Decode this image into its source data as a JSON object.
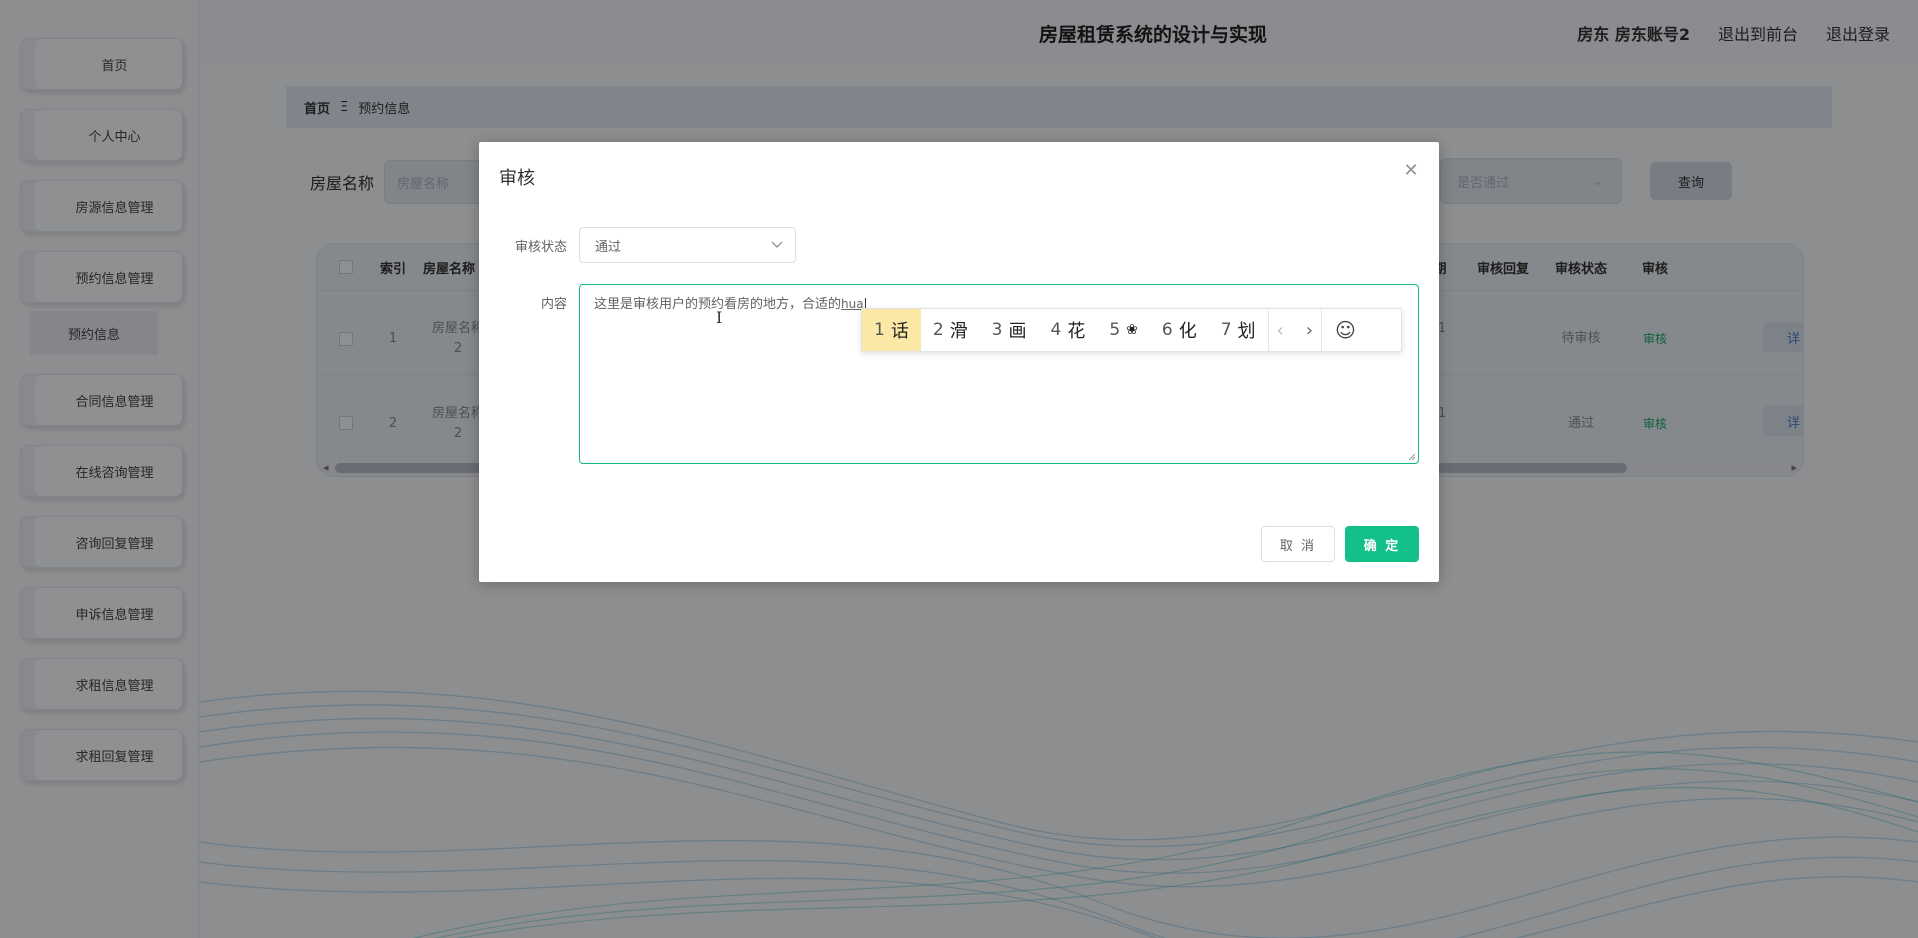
{
  "app": {
    "title": "房屋租赁系统的设计与实现",
    "user_label": "房东 房东账号2",
    "to_front": "退出到前台",
    "logout": "退出登录"
  },
  "sidebar": {
    "items": [
      {
        "label": "首页"
      },
      {
        "label": "个人中心"
      },
      {
        "label": "房源信息管理"
      },
      {
        "label": "预约信息管理"
      },
      {
        "label": "合同信息管理"
      },
      {
        "label": "在线咨询管理"
      },
      {
        "label": "咨询回复管理"
      },
      {
        "label": "申诉信息管理"
      },
      {
        "label": "求租信息管理"
      },
      {
        "label": "求租回复管理"
      }
    ],
    "sub_item": "预约信息"
  },
  "breadcrumb": {
    "home": "首页",
    "separator": "Ξ",
    "current": "预约信息"
  },
  "search": {
    "house_name_label": "房屋名称",
    "house_name_placeholder": "房屋名称",
    "passed_placeholder": "是否通过",
    "query_button": "查询"
  },
  "table": {
    "headers": {
      "index": "索引",
      "house_name": "房屋名称",
      "date_fragment": "期",
      "review_reply": "审核回复",
      "review_status": "审核状态",
      "review": "审核"
    },
    "rows": [
      {
        "index": "1",
        "house_name_line1": "房屋名称",
        "house_name_line2": "2",
        "date_fragment": "1",
        "status": "待审核",
        "review": "审核",
        "detail": "详"
      },
      {
        "index": "2",
        "house_name_line1": "房屋名称",
        "house_name_line2": "2",
        "date_fragment": "1",
        "status": "通过",
        "review": "审核",
        "detail": "详"
      }
    ]
  },
  "dialog": {
    "title": "审核",
    "status_label": "审核状态",
    "status_value": "通过",
    "content_label": "内容",
    "content_text": "这里是审核用户的预约看房的地方，合适的",
    "content_pinyin": "hua",
    "cancel": "取 消",
    "confirm": "确 定"
  },
  "ime": {
    "candidates": [
      {
        "num": "1",
        "text": "话"
      },
      {
        "num": "2",
        "text": "滑"
      },
      {
        "num": "3",
        "text": "画"
      },
      {
        "num": "4",
        "text": "花"
      },
      {
        "num": "5",
        "text": "❀"
      },
      {
        "num": "6",
        "text": "化"
      },
      {
        "num": "7",
        "text": "划"
      }
    ],
    "prev": "‹",
    "next": "›",
    "emoji": "☺"
  },
  "colors": {
    "accent": "#13c08a",
    "review_link": "#19a86b",
    "ime_highlight": "#fbe7a6"
  }
}
